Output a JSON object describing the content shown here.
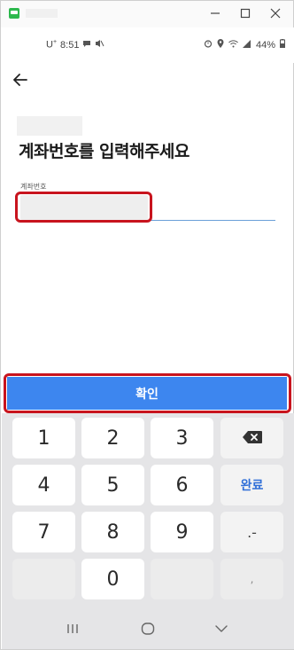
{
  "status_bar": {
    "carrier": "U",
    "carrier_sup": "+",
    "time": "8:51",
    "battery": "44%"
  },
  "screen": {
    "heading": "계좌번호를 입력해주세요",
    "field_label": "계좌번호",
    "field_value": "",
    "confirm_label": "확인"
  },
  "keypad": {
    "keys": [
      "1",
      "2",
      "3",
      "4",
      "5",
      "6",
      "7",
      "8",
      "9",
      "0"
    ],
    "done_label": "완료",
    "symbol_label": ".-",
    "comma_label": ","
  },
  "colors": {
    "accent": "#3d86ef",
    "highlight": "#c8141e"
  },
  "icons": [
    "app-icon",
    "minimize-icon",
    "maximize-icon",
    "close-icon",
    "message-icon",
    "mute-icon",
    "alarm-icon",
    "location-icon",
    "wifi-icon",
    "signal-icon",
    "battery-icon",
    "back-arrow-icon",
    "backspace-icon",
    "recents-icon",
    "home-icon",
    "nav-back-icon"
  ]
}
